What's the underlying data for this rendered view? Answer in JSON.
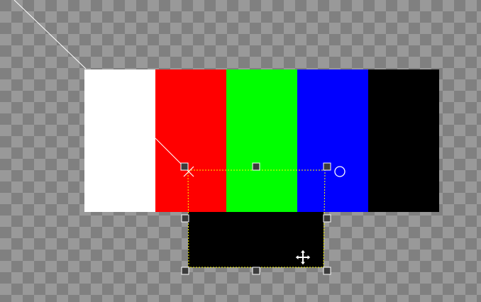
{
  "canvas": {
    "checker_dark": "#808080",
    "checker_light": "#999999"
  },
  "color_bars": [
    {
      "name": "white",
      "color": "#ffffff"
    },
    {
      "name": "red",
      "color": "#ff0000"
    },
    {
      "name": "green",
      "color": "#00ff00"
    },
    {
      "name": "blue",
      "color": "#0000ff"
    },
    {
      "name": "black",
      "color": "#000000"
    }
  ],
  "selected_layer": {
    "fill": "#000000"
  },
  "transform_tool": {
    "frame_color": "#ffff00",
    "handle_fill": "#3c3c3c",
    "handle_stroke": "#ffffff",
    "guide_line_color": "#ffffff",
    "pivot_icon": "x-mark-icon",
    "rotate_handle_icon": "circle-icon",
    "move_cursor_icon": "move-arrows-icon"
  }
}
